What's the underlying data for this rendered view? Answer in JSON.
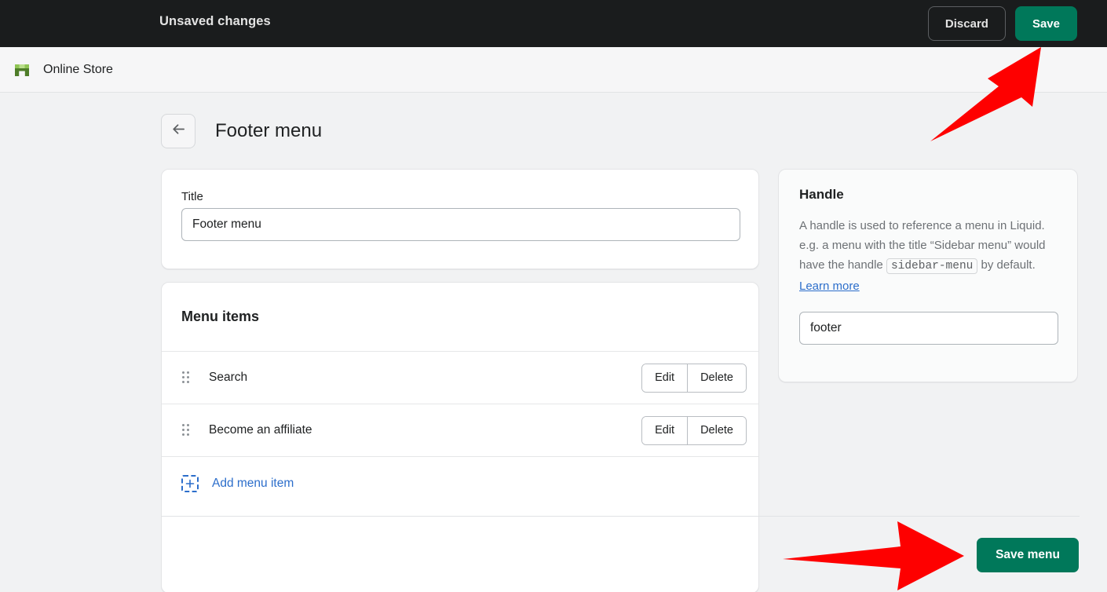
{
  "topbar": {
    "title": "Unsaved changes",
    "discard_label": "Discard",
    "save_label": "Save"
  },
  "storebar": {
    "store_name": "Online Store",
    "logo_icon": "shop-icon"
  },
  "page": {
    "back_icon": "arrow-left-icon",
    "title": "Footer menu"
  },
  "title_card": {
    "label": "Title",
    "value": "Footer menu",
    "placeholder": "Title"
  },
  "menu_items_card": {
    "heading": "Menu items",
    "rows": [
      {
        "label": "Search",
        "edit_label": "Edit",
        "delete_label": "Delete",
        "handle_icon": "drag-handle-icon"
      },
      {
        "label": "Become an affiliate",
        "edit_label": "Edit",
        "delete_label": "Delete",
        "handle_icon": "drag-handle-icon"
      }
    ],
    "add_label": "Add menu item",
    "add_icon": "add-plus-icon"
  },
  "handle_card": {
    "title": "Handle",
    "desc_part1": "A handle is used to reference a menu in Liquid. e.g. a menu with the title “Sidebar menu” would have the handle",
    "code_value": "sidebar-menu",
    "desc_part2": " by default. ",
    "learn_more_label": "Learn more",
    "input_value": "footer",
    "input_placeholder": "Handle"
  },
  "footer": {
    "save_menu_label": "Save menu"
  },
  "annotations": [
    {
      "name": "arrow-to-save-button",
      "icon": "red-arrow-up-right"
    },
    {
      "name": "arrow-to-save-menu-button",
      "icon": "red-arrow-right"
    }
  ],
  "colors": {
    "accent_green": "#00785a",
    "link_blue": "#2c6ecb",
    "topbar_dark": "#1a1c1d",
    "annotation_red": "#fe0000",
    "page_bg": "#f1f2f3"
  }
}
